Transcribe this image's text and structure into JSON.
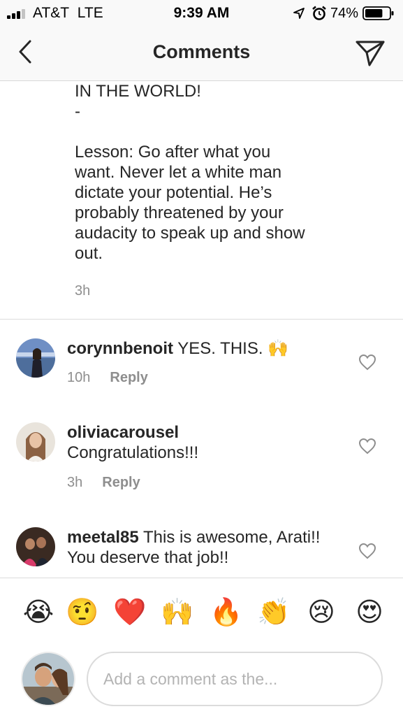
{
  "status_bar": {
    "carrier": "AT&T",
    "network": "LTE",
    "time": "9:39 AM",
    "battery_percent": "74%",
    "battery_level": 0.74,
    "signal_bars": 3
  },
  "nav": {
    "title": "Comments",
    "back_icon": "chevron-left-icon",
    "send_icon": "send-icon"
  },
  "caption": {
    "lines": [
      "IN THE WORLD!",
      "-",
      "",
      "Lesson: Go after what you",
      "want. Never let a white man",
      "dictate your potential. He’s",
      "probably threatened by your",
      "audacity to speak up and show",
      "out."
    ],
    "time": "3h"
  },
  "comments": [
    {
      "username": "corynnbenoit",
      "text": " YES. THIS. 🙌",
      "time": "10h",
      "reply": "Reply"
    },
    {
      "username": "oliviacarousel",
      "text": "Congratulations!!!",
      "time": "3h",
      "reply": "Reply"
    },
    {
      "username": "meetal85",
      "text": " This is awesome, Arati!! You deserve that job!!"
    }
  ],
  "emoji_bar": [
    "😭",
    "🤨",
    "❤️",
    "🙌",
    "🔥",
    "👏",
    "😢",
    "😍"
  ],
  "composer": {
    "placeholder": "Add a comment as the..."
  },
  "colors": {
    "text": "#262626",
    "secondary": "#8e8e8e",
    "divider": "#dbdbdb",
    "bar_background": "#f9f9f9"
  }
}
